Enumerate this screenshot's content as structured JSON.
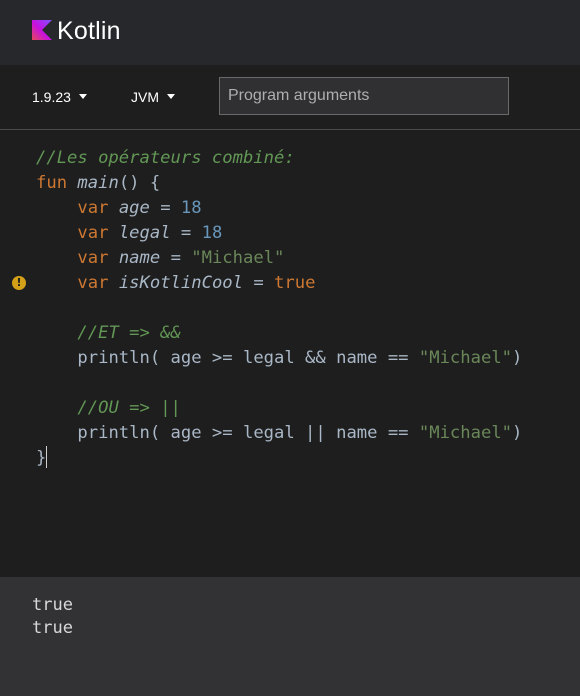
{
  "header": {
    "brand": "Kotlin",
    "logo_icon": "kotlin-logo-icon"
  },
  "toolbar": {
    "version": "1.9.23",
    "target": "JVM",
    "args_placeholder": "Program arguments",
    "args_value": ""
  },
  "editor": {
    "lines": {
      "l1": {
        "comment": "//Les opérateurs combiné:"
      },
      "l2": {
        "kw": "fun",
        "name": "main",
        "rest": "() {"
      },
      "l3": {
        "kw": "var",
        "name": "age",
        "eq": " = ",
        "value": "18"
      },
      "l4": {
        "kw": "var",
        "name": "legal",
        "eq": " = ",
        "value": "18"
      },
      "l5": {
        "kw": "var",
        "name": "name",
        "eq": " = ",
        "value": "\"Michael\""
      },
      "l6": {
        "kw": "var",
        "name": "isKotlinCool",
        "eq": " = ",
        "value": "true"
      },
      "l8": {
        "comment": "//ET => &&"
      },
      "l9": {
        "code": "println( age >= legal && name == ",
        "str": "\"Michael\"",
        "end": ")"
      },
      "l11": {
        "comment": "//OU => ||"
      },
      "l12": {
        "code": "println( age >= legal || name == ",
        "str": "\"Michael\"",
        "end": ")"
      },
      "l13": {
        "code": "}"
      }
    },
    "warning_icon_glyph": "!",
    "warning_icon": "warning-icon"
  },
  "output": {
    "lines": [
      "true",
      "true"
    ]
  },
  "colors": {
    "keyword": "#cc7832",
    "number": "#6897bb",
    "string": "#6a8759",
    "comment": "#629755",
    "text": "#a9b7c6",
    "warning": "#d4a017"
  }
}
